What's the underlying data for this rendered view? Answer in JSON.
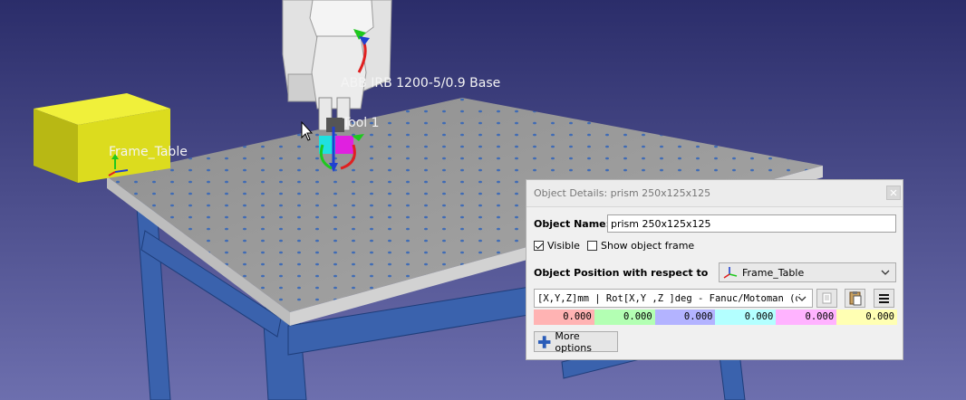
{
  "scene": {
    "robot_label": "ABB IRB 1200-5/0.9 Base",
    "tool_label": "Tool 1",
    "frame_label": "Frame_Table",
    "colors": {
      "background_top": "#2b2d6a",
      "background_bottom": "#6d6fae",
      "table_top": "#9c9c9c",
      "table_frame": "#3a62ad",
      "prism": "#dcdc1e"
    }
  },
  "dialog": {
    "title": "Object Details: prism 250x125x125",
    "object_name_label": "Object Name:",
    "object_name_value": "prism 250x125x125",
    "visible_label": "Visible",
    "visible_checked": true,
    "show_frame_label": "Show object frame",
    "show_frame_checked": false,
    "position_label": "Object Position with respect to",
    "reference_frame": "Frame_Table",
    "format": "[X,Y,Z]mm | Rot[X,Y ,Z  ]deg - Fanuc/Motoman (d",
    "values": [
      "0.000",
      "0.000",
      "0.000",
      "0.000",
      "0.000",
      "0.000"
    ],
    "value_colors": [
      "#ffb3b3",
      "#b3ffb3",
      "#b3b3ff",
      "#b3ffff",
      "#ffb3ff",
      "#ffffb3"
    ],
    "more_options_label": "More options",
    "icons": {
      "close": "close-icon",
      "frame": "frame-axes-icon",
      "dropdown": "chevron-down-icon",
      "copy": "copy-icon",
      "paste": "paste-icon",
      "menu": "menu-icon",
      "add": "plus-icon"
    }
  }
}
